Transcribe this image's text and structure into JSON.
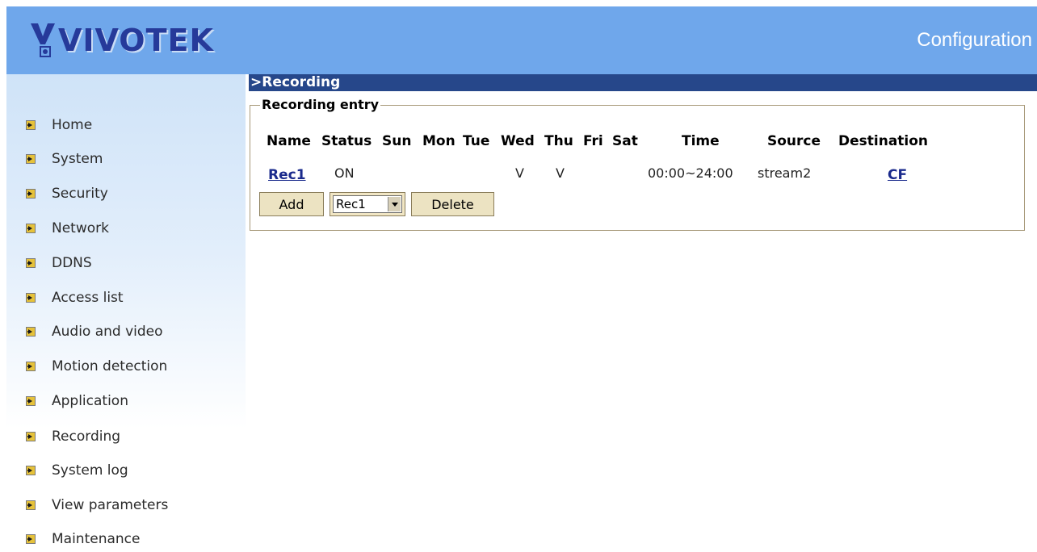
{
  "header": {
    "logo_text": "VIVOTEK",
    "title": "Configuration"
  },
  "sidebar": {
    "items": [
      {
        "label": "Home",
        "icon": "arrow-right-icon"
      },
      {
        "label": "System",
        "icon": "arrow-right-icon"
      },
      {
        "label": "Security",
        "icon": "arrow-right-icon"
      },
      {
        "label": "Network",
        "icon": "arrow-right-icon"
      },
      {
        "label": "DDNS",
        "icon": "arrow-right-icon"
      },
      {
        "label": "Access list",
        "icon": "arrow-right-icon"
      },
      {
        "label": "Audio and video",
        "icon": "arrow-right-icon"
      },
      {
        "label": "Motion detection",
        "icon": "arrow-right-icon"
      },
      {
        "label": "Application",
        "icon": "arrow-right-icon"
      },
      {
        "label": "Recording",
        "icon": "arrow-right-icon"
      },
      {
        "label": "System log",
        "icon": "arrow-right-icon"
      },
      {
        "label": "View parameters",
        "icon": "arrow-right-icon"
      },
      {
        "label": "Maintenance",
        "icon": "arrow-right-icon"
      }
    ]
  },
  "section": {
    "title": ">Recording"
  },
  "recording": {
    "legend": "Recording entry",
    "columns": [
      "Name",
      "Status",
      "Sun",
      "Mon",
      "Tue",
      "Wed",
      "Thu",
      "Fri",
      "Sat",
      "Time",
      "Source",
      "Destination"
    ],
    "rows": [
      {
        "name": "Rec1",
        "status": "ON",
        "wed": "V",
        "thu": "V",
        "time": "00:00~24:00",
        "source": "stream2",
        "destination": "CF"
      }
    ],
    "add_label": "Add",
    "select_value": "Rec1",
    "delete_label": "Delete"
  },
  "colors": {
    "header_bg": "#6fa7eb",
    "section_bar": "#26478a",
    "logo": "#263a9a",
    "link": "#1a2a8c",
    "button_bg": "#ece3c2"
  }
}
